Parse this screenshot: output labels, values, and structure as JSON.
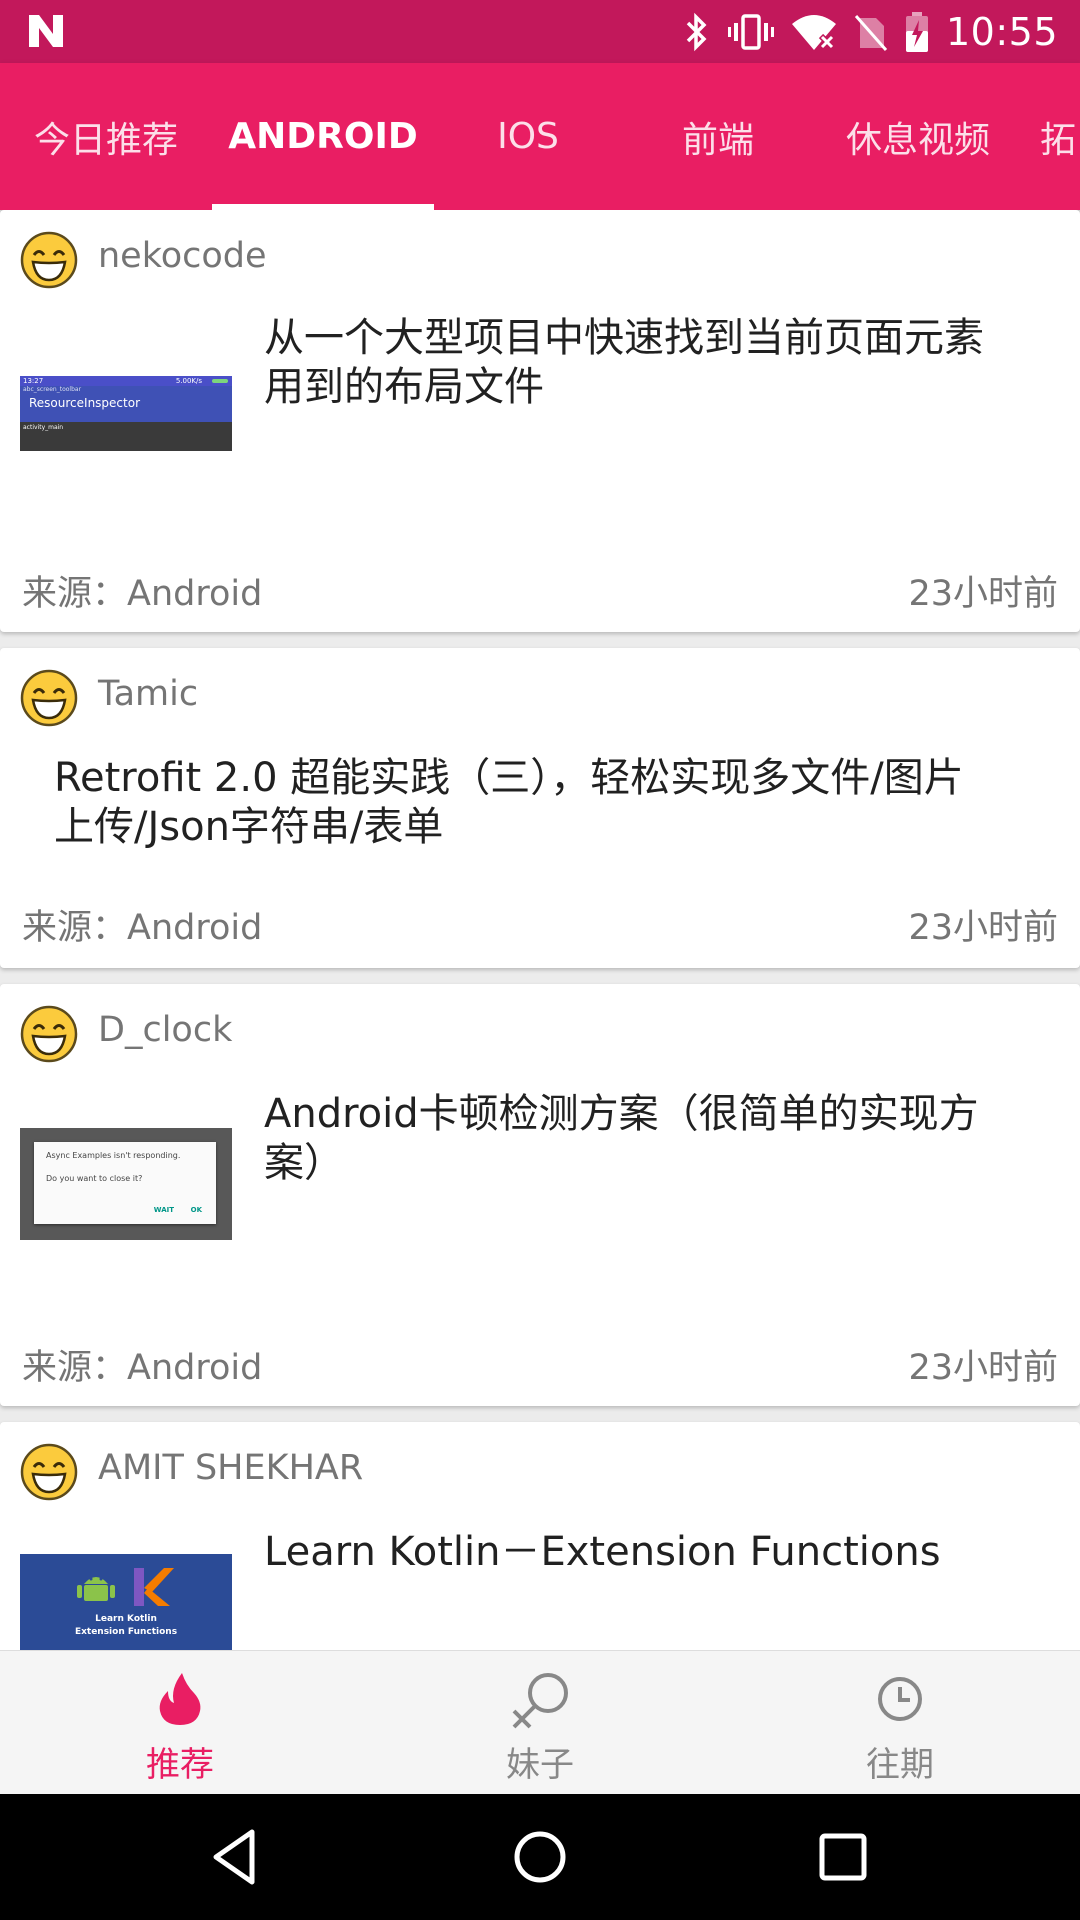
{
  "status_bar": {
    "time": "10:55"
  },
  "tabs": [
    {
      "label": "今日推荐"
    },
    {
      "label": "ANDROID"
    },
    {
      "label": "IOS"
    },
    {
      "label": "前端"
    },
    {
      "label": "休息视频"
    },
    {
      "label": "拓"
    }
  ],
  "feed": [
    {
      "author": "nekocode",
      "title_lines": [
        "从一个大型项目中快速找到当前页面元素",
        "用到的布局文件"
      ],
      "source": "来源：Android",
      "time": "23小时前",
      "thumb": {
        "status_time": "13:27",
        "status_speed": "5.00K/s",
        "toolbar_small": "abc_screen_toolbar",
        "toolbar_title": "ResourceInspector",
        "caption": "activity_main"
      }
    },
    {
      "author": "Tamic",
      "title_lines": [
        "Retrofit 2.0 超能实践（三），轻松实现多文件/图片",
        "上传/Json字符串/表单"
      ],
      "source": "来源：Android",
      "time": "23小时前"
    },
    {
      "author": "D_clock",
      "title_lines": [
        "Android卡顿检测方案（很简单的实现方",
        "案）"
      ],
      "source": "来源：Android",
      "time": "23小时前",
      "thumb": {
        "dialog_title": "Async Examples isn't responding.",
        "dialog_body": "Do you want to close it?",
        "wait": "WAIT",
        "ok": "OK"
      }
    },
    {
      "author": "AMIT SHEKHAR",
      "title_lines": [
        "Learn Kotlin－Extension Functions"
      ],
      "thumb": {
        "line1": "Learn Kotlin",
        "line2": "Extension Functions"
      }
    }
  ],
  "bottom_nav": [
    {
      "label": "推荐",
      "icon": "flame-icon"
    },
    {
      "label": "妹子",
      "icon": "female-icon"
    },
    {
      "label": "往期",
      "icon": "clock-icon"
    }
  ],
  "colors": {
    "status_bar": "#c2185b",
    "primary": "#e91e63",
    "text_secondary": "#757575"
  }
}
